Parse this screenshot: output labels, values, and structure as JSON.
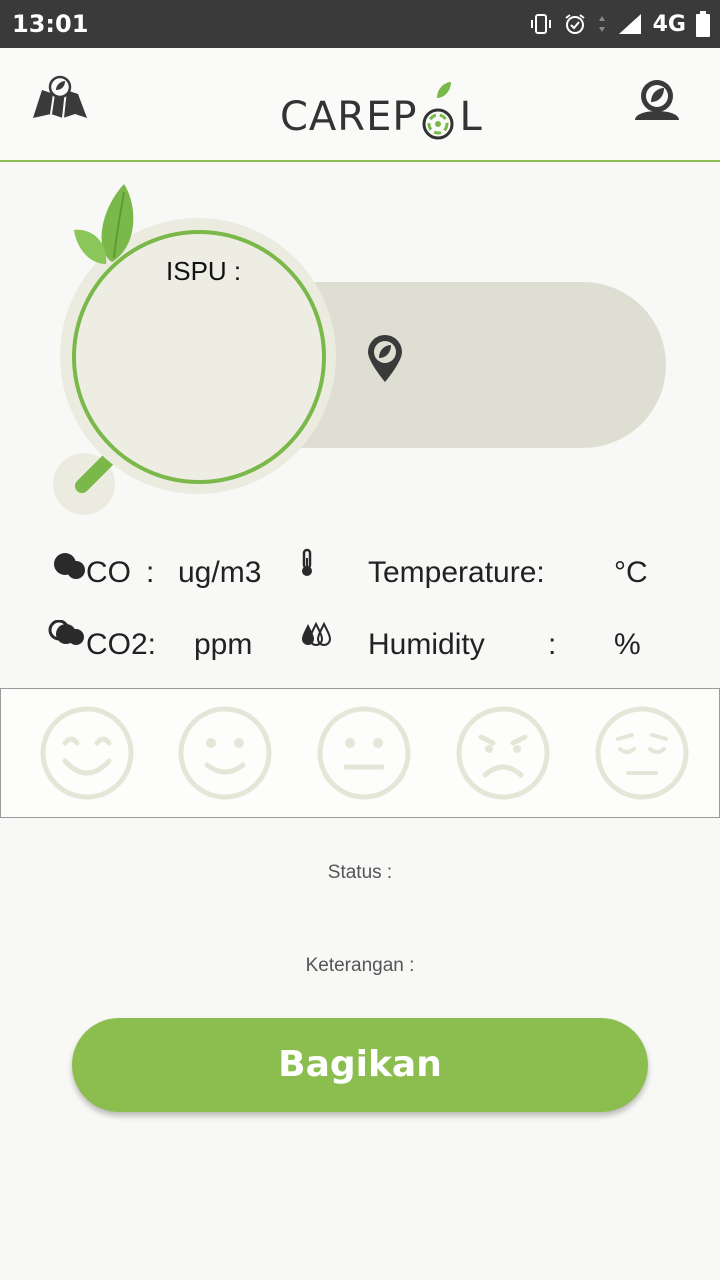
{
  "status_bar": {
    "time": "13:01",
    "network": "4G",
    "icons": [
      "vibrate-icon",
      "alarm-icon",
      "data-arrows-icon",
      "signal-icon",
      "battery-icon"
    ]
  },
  "app_bar": {
    "logo_text_left": "CAREP",
    "logo_text_right": "L",
    "left_icon": "map-leaf-icon",
    "right_icon": "profile-leaf-icon"
  },
  "gauge": {
    "label": "ISPU :",
    "location_icon": "location-pin-leaf-icon"
  },
  "readings": {
    "co_label": "CO",
    "co_sep": ":",
    "co_unit": "ug/m3",
    "co2_label": "CO2:",
    "co2_unit": "ppm",
    "temp_label": "Temperature:",
    "temp_unit": "°C",
    "humidity_label": "Humidity",
    "humidity_sep": ":",
    "humidity_unit": "%"
  },
  "faces": [
    "very-happy-face-icon",
    "happy-face-icon",
    "neutral-face-icon",
    "sad-face-icon",
    "sick-face-icon"
  ],
  "status_label": "Status :",
  "description_label": "Keterangan :",
  "share_button": "Bagikan",
  "colors": {
    "accent": "#8bbd4f",
    "gauge_ring": "#7ab84a",
    "panel": "#deded2",
    "status_bar": "#3a3a3a"
  }
}
